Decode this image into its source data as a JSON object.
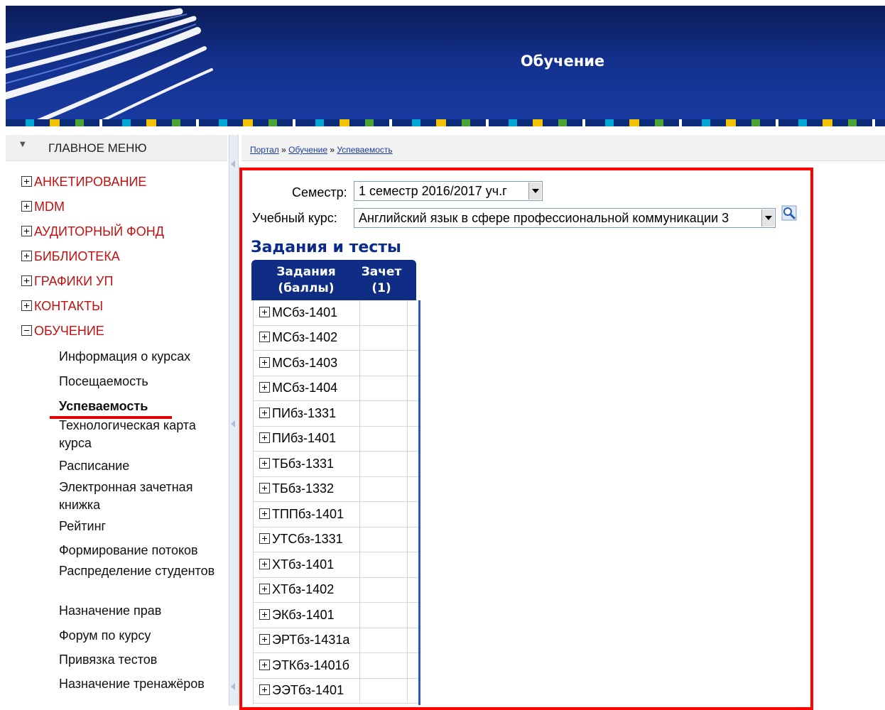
{
  "header": {
    "title": "Обучение"
  },
  "sidebar": {
    "title": "ГЛАВНОЕ МЕНЮ",
    "items": [
      {
        "label": "АНКЕТИРОВАНИЕ",
        "state": "collapsed"
      },
      {
        "label": "MDM",
        "state": "collapsed"
      },
      {
        "label": "АУДИТОРНЫЙ ФОНД",
        "state": "collapsed"
      },
      {
        "label": "БИБЛИОТЕКА",
        "state": "collapsed"
      },
      {
        "label": "ГРАФИКИ УП",
        "state": "collapsed"
      },
      {
        "label": "КОНТАКТЫ",
        "state": "collapsed"
      },
      {
        "label": "ОБУЧЕНИЕ",
        "state": "expanded"
      }
    ],
    "subitems": [
      "Информация о курсах",
      "Посещаемость",
      "Успеваемость",
      "Технологическая карта курса",
      "Расписание",
      "Электронная зачетная книжка",
      "Рейтинг",
      "Формирование потоков",
      "Распределение студентов",
      "Назначение прав",
      "Форум по курсу",
      "Привязка тестов",
      "Назначение тренажёров"
    ],
    "active_subitem": "Успеваемость"
  },
  "breadcrumb": {
    "items": [
      "Портал",
      "Обучение",
      "Успеваемость"
    ],
    "separator": "»"
  },
  "filters": {
    "semester_label": "Семестр:",
    "semester_value": "1 семестр 2016/2017 уч.г",
    "course_label": "Учебный курс:",
    "course_value": "Английский язык в сфере профессиональной коммуникации 3"
  },
  "grid": {
    "title": "Задания и тесты",
    "col1_header": "Задания (баллы)",
    "col2_header": "Зачет (1)",
    "groups": [
      "МСбз-1401",
      "МСбз-1402",
      "МСбз-1403",
      "МСбз-1404",
      "ПИбз-1331",
      "ПИбз-1401",
      "ТБбз-1331",
      "ТБбз-1332",
      "ТППбз-1401",
      "УТСбз-1331",
      "ХТбз-1401",
      "ХТбз-1402",
      "ЭКбз-1401",
      "ЭРТбз-1431а",
      "ЭТКбз-1401б",
      "ЭЭТбз-1401"
    ]
  },
  "colors": {
    "header_bg": "#13308c",
    "menu_red": "#c41010",
    "grid_header": "#0f2d85",
    "highlight_frame": "#ff0000"
  }
}
